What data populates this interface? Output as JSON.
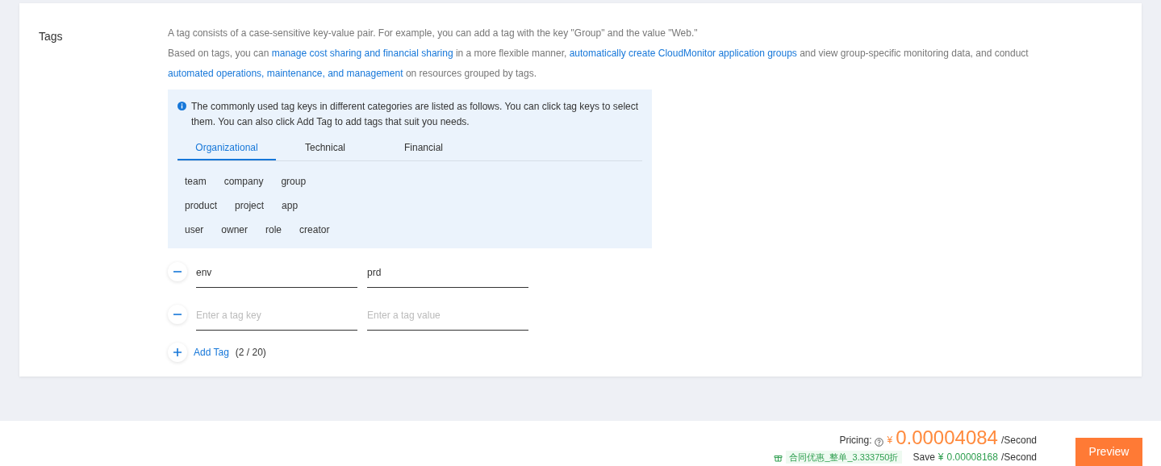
{
  "section": {
    "label": "Tags",
    "intro": "A tag consists of a case-sensitive key-value pair. For example, you can add a tag with the key \"Group\" and the value \"Web.\"",
    "description": [
      {
        "kind": "text",
        "text": "Based on tags, you can"
      },
      {
        "kind": "link",
        "text": "manage cost sharing and financial sharing"
      },
      {
        "kind": "text",
        "text": "in a more flexible manner,"
      },
      {
        "kind": "link",
        "text": "automatically create CloudMonitor application groups"
      },
      {
        "kind": "text",
        "text": "and view group-specific monitoring data, and conduct"
      },
      {
        "kind": "link",
        "text": "automated operations, maintenance, and management"
      },
      {
        "kind": "text",
        "text": "on resources grouped by tags."
      }
    ]
  },
  "suggestions": {
    "notice": "The commonly used tag keys in different categories are listed as follows. You can click tag keys to select them. You can also click Add Tag to add tags that suit you needs.",
    "tabs": [
      {
        "label": "Organizational",
        "selected": true
      },
      {
        "label": "Technical",
        "selected": false
      },
      {
        "label": "Financial",
        "selected": false
      }
    ],
    "key_rows": [
      [
        "team",
        "company",
        "group"
      ],
      [
        "product",
        "project",
        "app"
      ],
      [
        "user",
        "owner",
        "role",
        "creator"
      ]
    ]
  },
  "tags": [
    {
      "key": "env",
      "value": "prd"
    },
    {
      "key_placeholder": "Enter a tag key",
      "value_placeholder": "Enter a tag value"
    }
  ],
  "add_tag": {
    "label": "Add Tag",
    "count": "(2 / 20)"
  },
  "footer": {
    "pricing_label": "Pricing:",
    "currency": "¥",
    "price": "0.00004084",
    "unit": "/Second",
    "discount": "合同优惠_整单_3.333750折",
    "save_label": "Save",
    "save_currency": "¥",
    "save_amount": "0.00008168",
    "save_unit": "/Second",
    "button": "Preview"
  }
}
